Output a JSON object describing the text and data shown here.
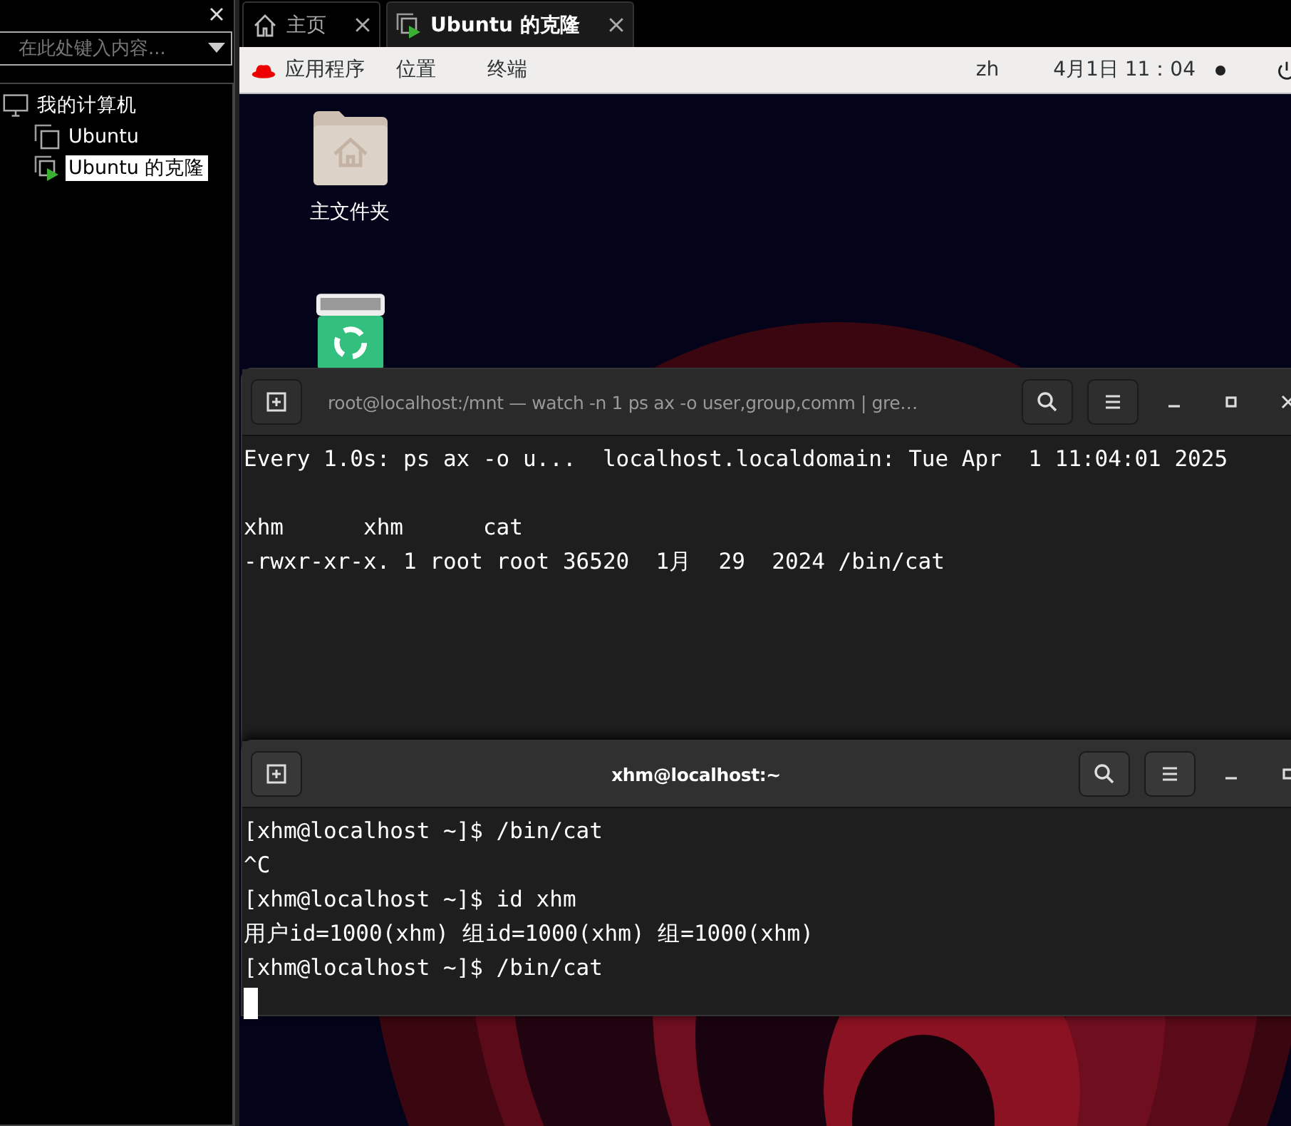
{
  "sidebar": {
    "search": {
      "placeholder": "在此处键入内容..."
    },
    "tree": [
      {
        "label": "我的计算机",
        "kind": "computer",
        "selected": false,
        "children": [
          {
            "label": "Ubuntu",
            "kind": "vm",
            "selected": false
          },
          {
            "label": "Ubuntu 的克隆",
            "kind": "vm-running",
            "selected": true
          }
        ]
      }
    ]
  },
  "tabs": [
    {
      "label": "主页",
      "kind": "home",
      "selected": false
    },
    {
      "label": "Ubuntu 的克隆",
      "kind": "vm-running",
      "selected": true
    }
  ],
  "topbar": {
    "menus": [
      "应用程序",
      "位置",
      "终端"
    ],
    "input_method": "zh",
    "clock": "4月1日  11：04"
  },
  "desktop_icons": [
    {
      "kind": "home-folder",
      "label": "主文件夹"
    },
    {
      "kind": "trash"
    }
  ],
  "terminals": [
    {
      "title": "root@localhost:/mnt — watch -n 1 ps ax -o user,group,comm | gre…",
      "focused": false,
      "cursor": false,
      "header": "Every 1.0s: ps ax -o u...  localhost.localdomain: Tue Apr  1 11:04:01 2025",
      "lines": [
        "xhm      xhm      cat",
        "-rwxr-xr-x. 1 root root 36520  1月  29  2024 /bin/cat"
      ]
    },
    {
      "title": "xhm@localhost:~",
      "focused": true,
      "cursor": true,
      "lines": [
        "[xhm@localhost ~]$ /bin/cat",
        "^C",
        "[xhm@localhost ~]$ id xhm",
        "用户id=1000(xhm) 组id=1000(xhm) 组=1000(xhm)",
        "[xhm@localhost ~]$ /bin/cat"
      ]
    }
  ]
}
